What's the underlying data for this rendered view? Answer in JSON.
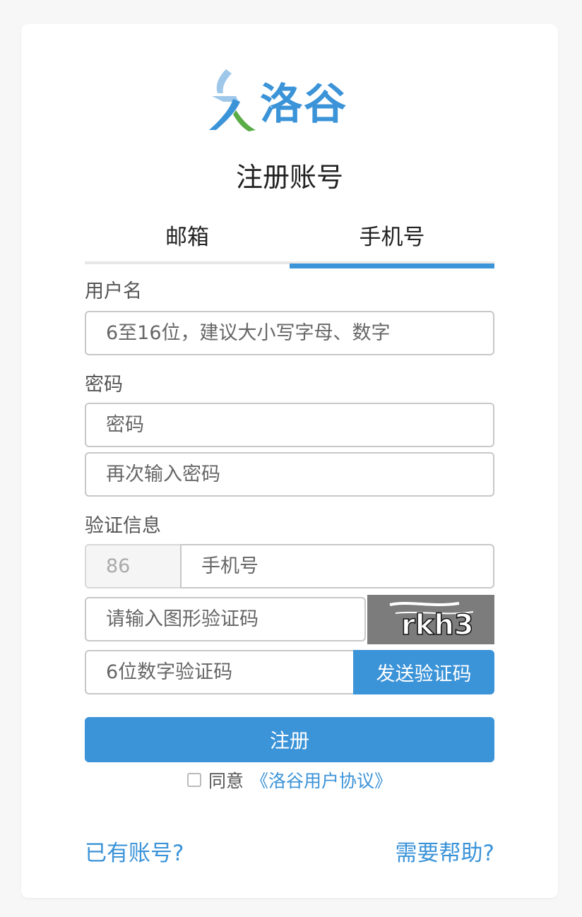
{
  "brand": {
    "name": "洛谷",
    "accent_color": "#3b93d8",
    "leaf_color": "#5aac47"
  },
  "page": {
    "title": "注册账号"
  },
  "tabs": [
    {
      "label": "邮箱",
      "active": false
    },
    {
      "label": "手机号",
      "active": true
    }
  ],
  "form": {
    "username_label": "用户名",
    "username_placeholder": "6至16位，建议大小写字母、数字",
    "password_label": "密码",
    "password_placeholder": "密码",
    "password_confirm_placeholder": "再次输入密码",
    "verify_label": "验证信息",
    "country_code": "86",
    "phone_placeholder": "手机号",
    "captcha_placeholder": "请输入图形验证码",
    "captcha_text": "rkh3",
    "sms_placeholder": "6位数字验证码",
    "send_code_label": "发送验证码",
    "register_label": "注册",
    "agree_text": "同意",
    "agreement_link": "《洛谷用户协议》"
  },
  "footer": {
    "have_account": "已有账号?",
    "need_help": "需要帮助?"
  }
}
